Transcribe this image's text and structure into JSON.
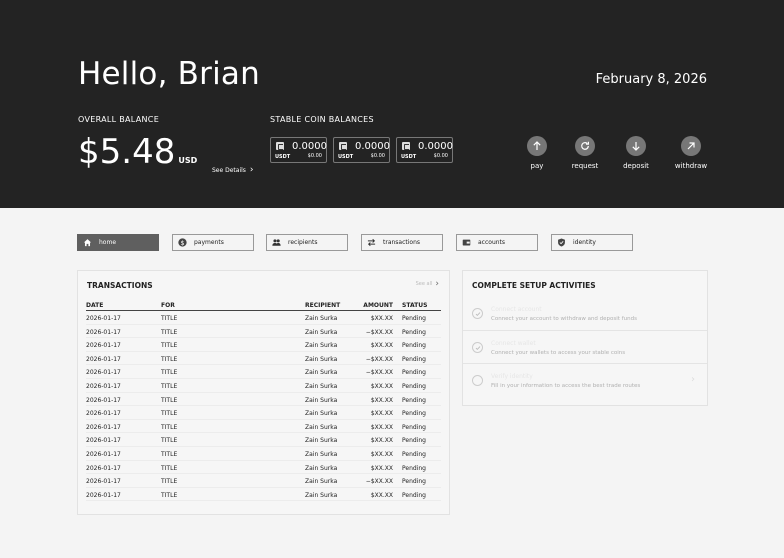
{
  "header": {
    "greeting": "Hello, Brian",
    "date": "February 8, 2026",
    "overall_balance_label": "OVERALL BALANCE",
    "balance_amount": "$5.48",
    "balance_currency": "USD",
    "see_details": "See Details",
    "stable_coin_label": "STABLE COIN BALANCES",
    "coins": [
      {
        "amount": "0.0000",
        "symbol": "USDT",
        "usd": "$0.00"
      },
      {
        "amount": "0.0000",
        "symbol": "USDT",
        "usd": "$0.00"
      },
      {
        "amount": "0.0000",
        "symbol": "USDT",
        "usd": "$0.00"
      }
    ],
    "actions": [
      {
        "label": "pay",
        "icon": "arrow-up-icon"
      },
      {
        "label": "request",
        "icon": "refresh-icon"
      },
      {
        "label": "deposit",
        "icon": "arrow-down-icon"
      },
      {
        "label": "withdraw",
        "icon": "arrow-up-right-icon"
      }
    ]
  },
  "tabs": [
    {
      "label": "home",
      "icon": "home-icon",
      "active": true
    },
    {
      "label": "payments",
      "icon": "dollar-icon",
      "active": false
    },
    {
      "label": "recipients",
      "icon": "users-icon",
      "active": false
    },
    {
      "label": "transactions",
      "icon": "transfer-icon",
      "active": false
    },
    {
      "label": "accounts",
      "icon": "wallet-icon",
      "active": false
    },
    {
      "label": "identity",
      "icon": "shield-icon",
      "active": false
    }
  ],
  "transactions": {
    "title": "TRANSACTIONS",
    "see_all": "See all",
    "columns": [
      "DATE",
      "FOR",
      "RECIPIENT",
      "AMOUNT",
      "STATUS"
    ],
    "rows": [
      {
        "date": "2026-01-17",
        "for": "TITLE",
        "recipient": "Zain Surka",
        "amount": "$XX.XX",
        "status": "Pending"
      },
      {
        "date": "2026-01-17",
        "for": "TITLE",
        "recipient": "Zain Surka",
        "amount": "−$XX.XX",
        "status": "Pending"
      },
      {
        "date": "2026-01-17",
        "for": "TITLE",
        "recipient": "Zain Surka",
        "amount": "$XX.XX",
        "status": "Pending"
      },
      {
        "date": "2026-01-17",
        "for": "TITLE",
        "recipient": "Zain Surka",
        "amount": "−$XX.XX",
        "status": "Pending"
      },
      {
        "date": "2026-01-17",
        "for": "TITLE",
        "recipient": "Zain Surka",
        "amount": "−$XX.XX",
        "status": "Pending"
      },
      {
        "date": "2026-01-17",
        "for": "TITLE",
        "recipient": "Zain Surka",
        "amount": "$XX.XX",
        "status": "Pending"
      },
      {
        "date": "2026-01-17",
        "for": "TITLE",
        "recipient": "Zain Surka",
        "amount": "$XX.XX",
        "status": "Pending"
      },
      {
        "date": "2026-01-17",
        "for": "TITLE",
        "recipient": "Zain Surka",
        "amount": "$XX.XX",
        "status": "Pending"
      },
      {
        "date": "2026-01-17",
        "for": "TITLE",
        "recipient": "Zain Surka",
        "amount": "$XX.XX",
        "status": "Pending"
      },
      {
        "date": "2026-01-17",
        "for": "TITLE",
        "recipient": "Zain Surka",
        "amount": "$XX.XX",
        "status": "Pending"
      },
      {
        "date": "2026-01-17",
        "for": "TITLE",
        "recipient": "Zain Surka",
        "amount": "$XX.XX",
        "status": "Pending"
      },
      {
        "date": "2026-01-17",
        "for": "TITLE",
        "recipient": "Zain Surka",
        "amount": "$XX.XX",
        "status": "Pending"
      },
      {
        "date": "2026-01-17",
        "for": "TITLE",
        "recipient": "Zain Surka",
        "amount": "−$XX.XX",
        "status": "Pending"
      },
      {
        "date": "2026-01-17",
        "for": "TITLE",
        "recipient": "Zain Surka",
        "amount": "$XX.XX",
        "status": "Pending"
      }
    ]
  },
  "setup": {
    "title": "COMPLETE SETUP ACTIVITIES",
    "items": [
      {
        "title": "Connect account",
        "description": "Connect your account to withdraw and deposit funds",
        "done": true
      },
      {
        "title": "Connect wallet",
        "description": "Connect your wallets to access your stable coins",
        "done": true
      },
      {
        "title": "Verify identity",
        "description": "Fill in your information to access the best trade routes",
        "done": false
      }
    ]
  },
  "colors": {
    "header_bg": "#232323",
    "active_tab": "#5f5f5f",
    "action_circle": "#777777"
  }
}
